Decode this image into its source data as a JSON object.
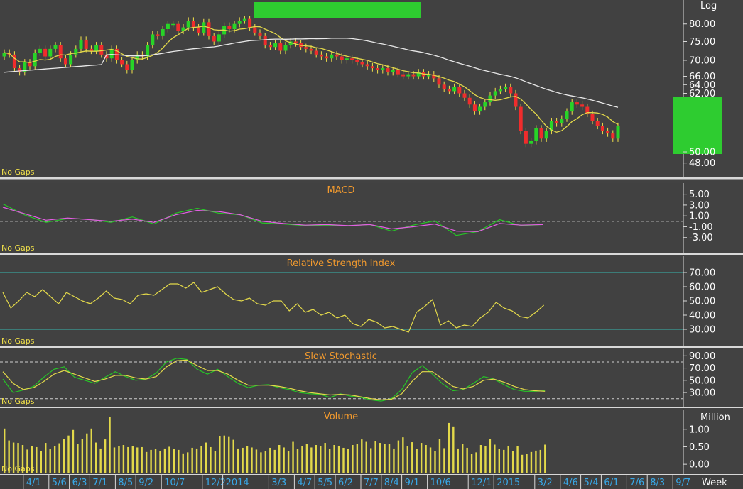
{
  "chart_data": [
    {
      "type": "candlestick",
      "panel": "price",
      "scale_label": "Log",
      "footer_label": "No Gaps",
      "y_scale": "log",
      "ylim": [
        46,
        86
      ],
      "y_ticks": [
        48,
        50,
        62,
        64,
        66,
        70,
        75,
        80
      ],
      "y_tick_labels": [
        "48.00",
        "50.00",
        "62.00",
        "64.00",
        "66.00",
        "70.00",
        "75.00",
        "80.00"
      ],
      "weekly_close": [
        72,
        71.5,
        68,
        67,
        69.5,
        68.5,
        72,
        73,
        71,
        73,
        74,
        70.5,
        69,
        71.5,
        73,
        75.5,
        73,
        72.5,
        74,
        71.5,
        70.5,
        73,
        70,
        69,
        67.5,
        70,
        71.5,
        71,
        74,
        77,
        76.5,
        78.5,
        80,
        80,
        78,
        79,
        81,
        79,
        77.5,
        80.5,
        76.5,
        75,
        77,
        79.5,
        78.5,
        80,
        81,
        81.5,
        79,
        77.5,
        76.5,
        74,
        73.5,
        74.5,
        72.5,
        74,
        75,
        74.5,
        73.5,
        73,
        72.5,
        71.5,
        71,
        70.5,
        71.5,
        71,
        70,
        70.5,
        70,
        69.5,
        69,
        68.5,
        68,
        67.5,
        68,
        67,
        67.5,
        66.5,
        66,
        66.5,
        66,
        67,
        66,
        66.5,
        65.5,
        64,
        63,
        62.5,
        63.5,
        62,
        61,
        59.5,
        58,
        59,
        60,
        61.5,
        62.5,
        63,
        63.5,
        62,
        59,
        54,
        51.5,
        52,
        54.5,
        52.5,
        54,
        56,
        55.5,
        56.5,
        58,
        60,
        59.5,
        59,
        57.5,
        56,
        55,
        54,
        53.5,
        52.5,
        55
      ],
      "ma_short_name": "",
      "ma_long_name": "",
      "ma_short_color": "#e3d94a",
      "ma_long_color": "#e8e8e8",
      "up_color": "#27d427",
      "down_color": "#f02c2c",
      "highlight_color": "#2ecc30"
    },
    {
      "type": "line",
      "panel": "macd",
      "title": "MACD",
      "footer_label": "No Gaps",
      "ylim": [
        -5,
        6
      ],
      "y_ticks": [
        5,
        3,
        1,
        -1,
        -3
      ],
      "y_tick_labels": [
        "5.00",
        "3.00",
        "1.00",
        "-1.00",
        "-3.00"
      ],
      "zero_line": 0,
      "series": [
        {
          "name": "",
          "color": "#27c427",
          "values": [
            3.2,
            1.2,
            -0.2,
            0.5,
            0.4,
            -0.2,
            0.8,
            -0.5,
            1.5,
            2.4,
            1.5,
            1.2,
            -0.3,
            -0.5,
            -0.8,
            -0.7,
            -0.8,
            -0.6,
            -1.8,
            -0.7,
            0.1,
            -2.6,
            -1.9,
            0.3,
            -0.8,
            -0.6
          ]
        },
        {
          "name": "",
          "color": "#e35ee3",
          "values": [
            2.6,
            1.4,
            0.2,
            0.6,
            0.3,
            0,
            0.4,
            -0.2,
            1.2,
            2,
            1.8,
            1.2,
            0,
            -0.4,
            -0.7,
            -0.6,
            -0.8,
            -0.6,
            -1.4,
            -1,
            -0.5,
            -1.8,
            -1.9,
            -0.4,
            -0.7,
            -0.6
          ]
        }
      ]
    },
    {
      "type": "line",
      "panel": "rsi",
      "title": "Relative Strength Index",
      "footer_label": "No Gaps",
      "ylim": [
        20,
        76
      ],
      "y_ticks": [
        70,
        60,
        50,
        40,
        30
      ],
      "y_tick_labels": [
        "70.00",
        "60.00",
        "50.00",
        "40.00",
        "30.00"
      ],
      "bands": [
        70,
        30
      ],
      "series": [
        {
          "name": "",
          "color": "#e3d94a",
          "values": [
            56,
            45,
            50,
            56,
            53,
            58,
            53,
            48,
            56,
            53,
            50,
            48,
            52,
            57,
            52,
            51,
            48,
            54,
            55,
            54,
            58,
            62,
            62,
            59,
            63,
            56,
            58,
            60,
            55,
            51,
            50,
            52,
            48,
            47,
            50,
            50,
            43,
            48,
            42,
            44,
            40,
            42,
            38,
            40,
            34,
            32,
            37,
            35,
            31,
            32,
            30,
            28,
            42,
            46,
            51,
            33,
            36,
            31,
            33,
            32,
            38,
            42,
            49,
            45,
            43,
            39,
            38,
            42,
            47
          ]
        }
      ]
    },
    {
      "type": "line",
      "panel": "stochastic",
      "title": "Slow Stochastic",
      "footer_label": "No Gaps",
      "ylim": [
        15,
        95
      ],
      "y_ticks": [
        90,
        70,
        50,
        30
      ],
      "y_tick_labels": [
        "90.00",
        "70.00",
        "50.00",
        "30.00"
      ],
      "bands": [
        80,
        20
      ],
      "series": [
        {
          "name": "",
          "color": "#27c427",
          "values": [
            52,
            30,
            34,
            40,
            55,
            68,
            72,
            55,
            50,
            45,
            55,
            64,
            56,
            50,
            52,
            62,
            80,
            86,
            84,
            68,
            60,
            68,
            56,
            45,
            38,
            42,
            43,
            38,
            35,
            30,
            28,
            27,
            22,
            28,
            24,
            22,
            18,
            16,
            20,
            35,
            62,
            74,
            60,
            44,
            33,
            35,
            45,
            56,
            52,
            43,
            35,
            32,
            32,
            33
          ]
        },
        {
          "name": "",
          "color": "#e3d94a",
          "values": [
            64,
            45,
            35,
            38,
            48,
            60,
            66,
            60,
            54,
            48,
            52,
            58,
            58,
            54,
            52,
            56,
            72,
            82,
            83,
            74,
            66,
            66,
            60,
            50,
            42,
            42,
            42,
            40,
            37,
            33,
            30,
            28,
            26,
            27,
            26,
            23,
            20,
            18,
            19,
            28,
            48,
            64,
            64,
            52,
            40,
            36,
            40,
            50,
            52,
            47,
            40,
            35,
            33,
            32
          ]
        }
      ]
    },
    {
      "type": "bar",
      "panel": "volume",
      "title": "Volume",
      "footer_label": "No Gaps",
      "unit_label": "Million",
      "ylim": [
        -0.2,
        1.3
      ],
      "y_ticks": [
        1,
        0.5,
        0
      ],
      "y_tick_labels": [
        "1.00",
        "0.50",
        "0.00"
      ],
      "color": "#e3d94a",
      "values": [
        1.02,
        0.68,
        0.62,
        0.61,
        0.55,
        0.42,
        0.52,
        0.49,
        0.38,
        0.61,
        0.43,
        0.51,
        0.6,
        0.72,
        0.82,
        0.98,
        0.58,
        0.73,
        0.88,
        1.02,
        0.62,
        0.45,
        0.71,
        1.35,
        0.48,
        0.51,
        0.55,
        0.49,
        0.52,
        0.48,
        0.49,
        0.35,
        0.41,
        0.44,
        0.37,
        0.45,
        0.5,
        0.44,
        0.41,
        0.31,
        0.34,
        0.47,
        0.45,
        0.53,
        0.62,
        0.49,
        0.38,
        0.8,
        0.82,
        0.78,
        0.7,
        0.45,
        0.47,
        0.52,
        0.48,
        0.42,
        0.34,
        0.37,
        0.47,
        0.41,
        0.55,
        0.48,
        0.38,
        0.64,
        0.43,
        0.52,
        0.58,
        0.48,
        0.55,
        0.53,
        0.61,
        0.44,
        0.55,
        0.53,
        0.47,
        0.43,
        0.55,
        0.59,
        0.71,
        0.64,
        0.46,
        0.66,
        0.61,
        0.59,
        0.58,
        0.45,
        0.68,
        0.77,
        0.51,
        0.63,
        0.43,
        0.61,
        0.55,
        0.48,
        0.37,
        0.73,
        0.46,
        1.18,
        1.08,
        0.45,
        0.58,
        0.47,
        0.3,
        0.34,
        0.55,
        0.52,
        0.72,
        0.56,
        0.44,
        0.41,
        0.53,
        0.37,
        0.51,
        0.27,
        0.3,
        0.35,
        0.39,
        0.41,
        0.56
      ]
    }
  ],
  "x_axis": {
    "unit_label": "Week",
    "ticks": [
      {
        "label": "4/1",
        "i": 4
      },
      {
        "label": "5/6",
        "i": 9
      },
      {
        "label": "6/3",
        "i": 13
      },
      {
        "label": "7/1",
        "i": 17
      },
      {
        "label": "8/5",
        "i": 22
      },
      {
        "label": "9/2",
        "i": 26
      },
      {
        "label": "10/7",
        "i": 31
      },
      {
        "label": "12/2",
        "i": 39
      },
      {
        "label": "2014",
        "i": 43
      },
      {
        "label": "3/3",
        "i": 52
      },
      {
        "label": "4/7",
        "i": 57
      },
      {
        "label": "5/5",
        "i": 61
      },
      {
        "label": "6/2",
        "i": 65
      },
      {
        "label": "7/7",
        "i": 70
      },
      {
        "label": "8/4",
        "i": 74
      },
      {
        "label": "9/1",
        "i": 78
      },
      {
        "label": "10/6",
        "i": 83
      },
      {
        "label": "12/1",
        "i": 91
      },
      {
        "label": "2015",
        "i": 96
      },
      {
        "label": "3/2",
        "i": 104
      },
      {
        "label": "4/6",
        "i": 109
      },
      {
        "label": "5/4",
        "i": 113
      },
      {
        "label": "6/1",
        "i": 117
      },
      {
        "label": "7/6",
        "i": 122
      },
      {
        "label": "8/3",
        "i": 126
      },
      {
        "label": "9/7",
        "i": 131
      }
    ]
  }
}
